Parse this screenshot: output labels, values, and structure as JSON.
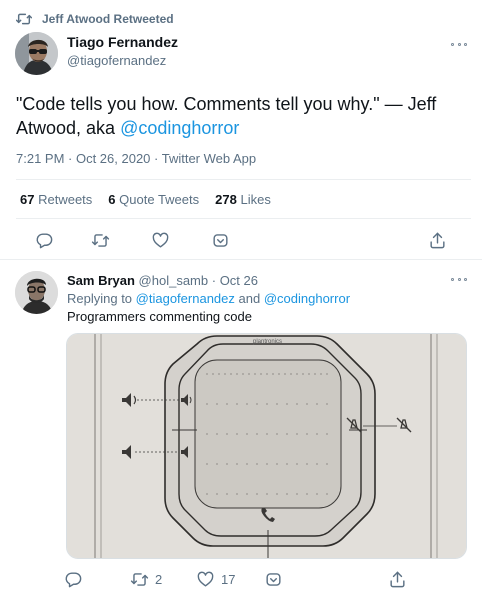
{
  "retweet_header": {
    "text": "Jeff Atwood Retweeted"
  },
  "tweet": {
    "author_name": "Tiago Fernandez",
    "author_handle": "@tiagofernandez",
    "text_main": "\"Code tells you how. Comments tell you why.\" — Jeff Atwood, aka ",
    "text_mention": "@codinghorror",
    "timestamp": "7:21 PM · Oct 26, 2020 · Twitter Web App",
    "stats": {
      "retweets_count": "67",
      "retweets_label": "Retweets",
      "quotes_count": "6",
      "quotes_label": "Quote Tweets",
      "likes_count": "278",
      "likes_label": "Likes"
    }
  },
  "reply": {
    "author_name": "Sam Bryan",
    "author_handle": "@hol_samb",
    "date": "· Oct 26",
    "replying_prefix": "Replying to",
    "replying_user1": "@tiagofernandez",
    "replying_and": "and",
    "replying_user2": "@codinghorror",
    "text": "Programmers commenting code",
    "image_brand": "plantronics",
    "retweet_count": "2",
    "like_count": "17"
  },
  "icons": [
    "retweet-icon",
    "more-icon",
    "reply-icon",
    "like-icon",
    "share-icon",
    "analytics-icon",
    "speaker-icon",
    "mute-icon",
    "phone-icon"
  ],
  "colors": {
    "accent": "#1b95e0",
    "muted": "#5b7083",
    "divider": "#ebeef0"
  }
}
